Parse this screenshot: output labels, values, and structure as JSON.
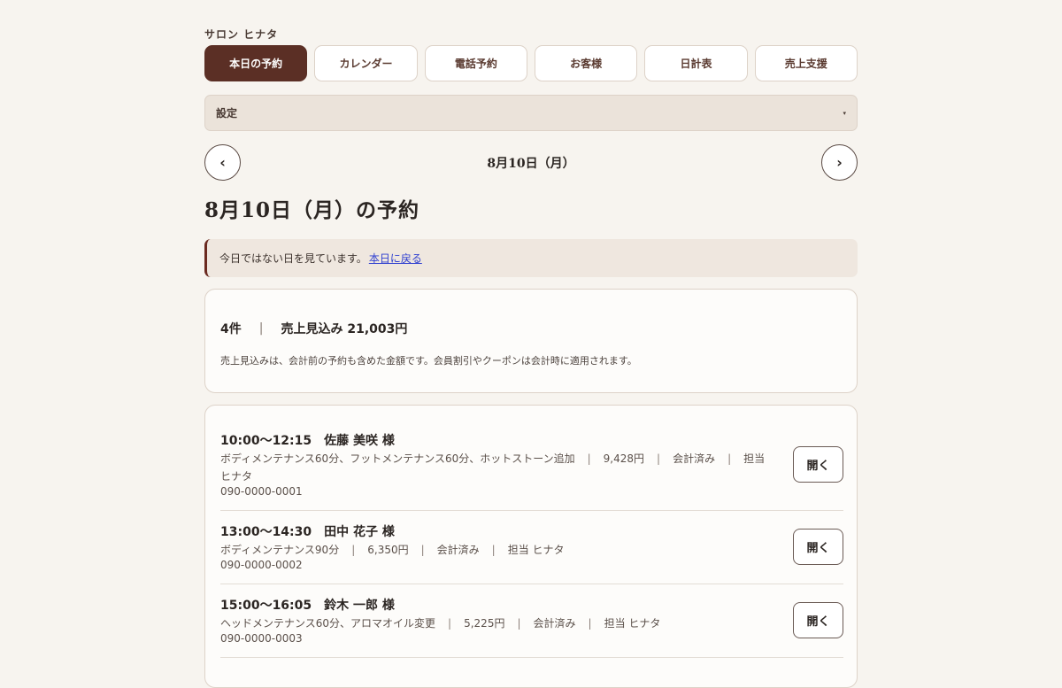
{
  "salon_name": "サロン ヒナタ",
  "tabs": [
    {
      "label": "本日の予約",
      "active": true
    },
    {
      "label": "カレンダー",
      "active": false
    },
    {
      "label": "電話予約",
      "active": false
    },
    {
      "label": "お客様",
      "active": false
    },
    {
      "label": "日計表",
      "active": false
    },
    {
      "label": "売上支援",
      "active": false
    }
  ],
  "settings": {
    "label": "設定",
    "caret": "▾"
  },
  "date_nav": {
    "prev": "‹",
    "date": "8月10日（月）",
    "next": "›"
  },
  "page_title": "8月10日（月）の予約",
  "notice": {
    "text": "今日ではない日を見ています。",
    "link": "本日に戻る"
  },
  "summary": {
    "count": "4件",
    "separator": "|",
    "sales": "売上見込み 21,003円",
    "note": "売上見込みは、会計前の予約も含めた金額です。会員割引やクーポンは会計時に適用されます。"
  },
  "reservations": [
    {
      "time_name": "10:00〜12:15　佐藤 美咲 様",
      "menu": "ボディメンテナンス60分、フットメンテナンス60分、ホットストーン追加",
      "price": "9,428円",
      "status": "会計済み",
      "staff": "担当 ヒナタ",
      "phone": "090-0000-0001",
      "button": "開く"
    },
    {
      "time_name": "13:00〜14:30　田中 花子 様",
      "menu": "ボディメンテナンス90分",
      "price": "6,350円",
      "status": "会計済み",
      "staff": "担当 ヒナタ",
      "phone": "090-0000-0002",
      "button": "開く"
    },
    {
      "time_name": "15:00〜16:05　鈴木 一郎 様",
      "menu": "ヘッドメンテナンス60分、アロマオイル変更",
      "price": "5,225円",
      "status": "会計済み",
      "staff": "担当 ヒナタ",
      "phone": "090-0000-0003",
      "button": "開く"
    }
  ],
  "meta_separator": "|",
  "colors": {
    "accent": "#5b2f25",
    "background": "#f7f4ef",
    "notice_border": "#6b2a20",
    "link": "#2f3fd0"
  }
}
